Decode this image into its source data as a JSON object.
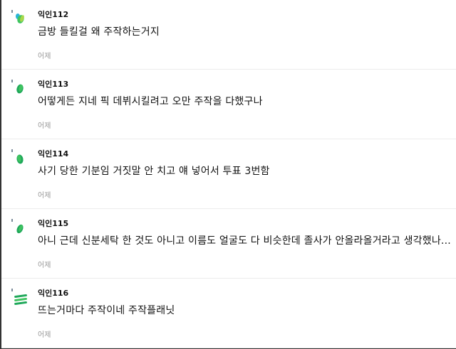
{
  "comments": [
    {
      "nickname": "익인112",
      "text": "금방 들킬걸 왜 주작하는거지",
      "date": "어제",
      "avatar_icon": "green-blob-avatar-icon",
      "avatar_colors": [
        "#2bb5d9",
        "#3fc460",
        "#a8d84a"
      ]
    },
    {
      "nickname": "익인113",
      "text": "어떻게든 지네 픽 데뷔시킬려고 오만 주작을 다했구나",
      "date": "어제",
      "avatar_icon": "green-blob-avatar-icon",
      "avatar_colors": [
        "#1fa85a",
        "#3fc460"
      ]
    },
    {
      "nickname": "익인114",
      "text": "사기 당한 기분임 거짓말 안 치고 얘 넣어서 투표 3번함",
      "date": "어제",
      "avatar_icon": "green-blob-avatar-icon",
      "avatar_colors": [
        "#1fa85a",
        "#3fc460"
      ]
    },
    {
      "nickname": "익인115",
      "text": "아니 근데 신분세탁 한 것도 아니고 이름도 얼굴도 다 비슷한데 졸사가 안올라올거라고 생각했나...",
      "date": "어제",
      "avatar_icon": "green-blob-avatar-icon",
      "avatar_colors": [
        "#1fa85a",
        "#3fc460"
      ]
    },
    {
      "nickname": "익인116",
      "text": "뜨는거마다 주작이네 주작플래닛",
      "date": "어제",
      "avatar_icon": "green-stripes-avatar-icon",
      "avatar_colors": [
        "#1fa85a",
        "#3fc460"
      ]
    }
  ]
}
